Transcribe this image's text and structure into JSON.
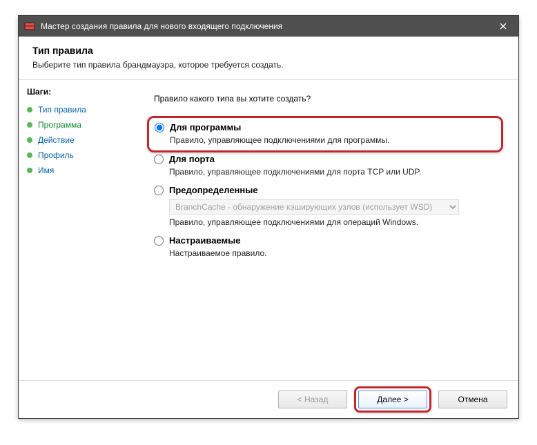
{
  "titlebar": {
    "title": "Мастер создания правила для нового входящего подключения"
  },
  "header": {
    "h1": "Тип правила",
    "sub": "Выберите тип правила брандмауэра, которое требуется создать."
  },
  "sidebar": {
    "steps_label": "Шаги:",
    "steps": [
      {
        "label": "Тип правила"
      },
      {
        "label": "Программа"
      },
      {
        "label": "Действие"
      },
      {
        "label": "Профиль"
      },
      {
        "label": "Имя"
      }
    ]
  },
  "content": {
    "prompt": "Правило какого типа вы хотите создать?",
    "options": [
      {
        "title": "Для программы",
        "desc": "Правило, управляющее подключениями для программы."
      },
      {
        "title": "Для порта",
        "desc": "Правило, управляющее подключениями для порта TCP или UDP."
      },
      {
        "title": "Предопределенные",
        "select_value": "BranchCache - обнаружение кэширующих узлов (использует WSD)",
        "desc": "Правило, управляющее подключениями для операций Windows."
      },
      {
        "title": "Настраиваемые",
        "desc": "Настраиваемое правило."
      }
    ]
  },
  "footer": {
    "back": "< Назад",
    "next": "Далее >",
    "cancel": "Отмена"
  }
}
